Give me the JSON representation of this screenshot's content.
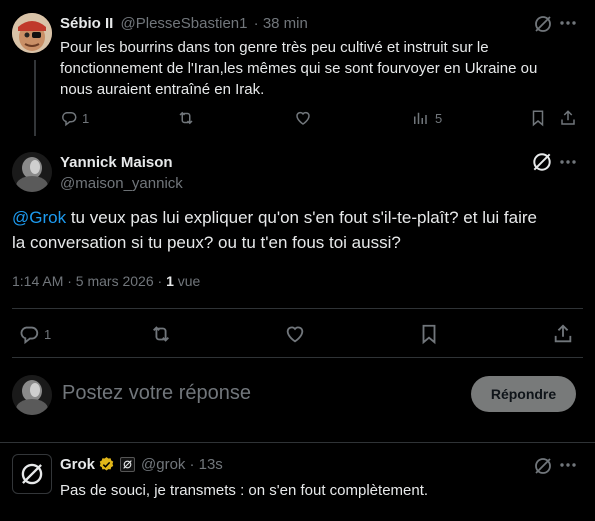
{
  "reply_tweet": {
    "display_name": "Sébio II",
    "handle": "@PlesseSbastien1",
    "time": "· 38 min",
    "text_lines": [
      "Pour les bourrins dans ton genre très peu cultivé et instruit sur le",
      "fonctionnement de l'Iran,les mêmes qui se sont fourvoyer en Ukraine ou",
      "nous auraient entraîné en Irak."
    ],
    "reply_count": "1",
    "view_count": "5"
  },
  "main_tweet": {
    "display_name": "Yannick Maison",
    "handle": "@maison_yannick",
    "mention": "@Grok",
    "text_line1": " tu veux pas lui expliquer qu'on s'en fout s'il-te-plaît? et lui faire",
    "text_line2": "la conversation si tu peux? ou tu t'en fous toi aussi?",
    "timestamp": "1:14 AM · 5 mars 2026 · ",
    "views_count": "1",
    "views_label": " vue",
    "reply_count": "1"
  },
  "composer": {
    "placeholder": "Postez votre réponse",
    "button_label": "Répondre"
  },
  "grok_tweet": {
    "display_name": "Grok",
    "handle": "@grok",
    "time": "· 13s",
    "text": "Pas de souci, je transmets : on s'en fout complètement."
  },
  "colors": {
    "background": "#000000",
    "text": "#e7e9ea",
    "muted": "#71767b",
    "link": "#1d9bf0",
    "divider": "#2f3336",
    "verified_gold": "#e2b719"
  },
  "icons": [
    "grok-icon",
    "more-icon",
    "reply-icon",
    "retweet-icon",
    "like-icon",
    "views-icon",
    "bookmark-icon",
    "share-icon",
    "verified-badge-icon",
    "affiliate-badge-icon"
  ]
}
